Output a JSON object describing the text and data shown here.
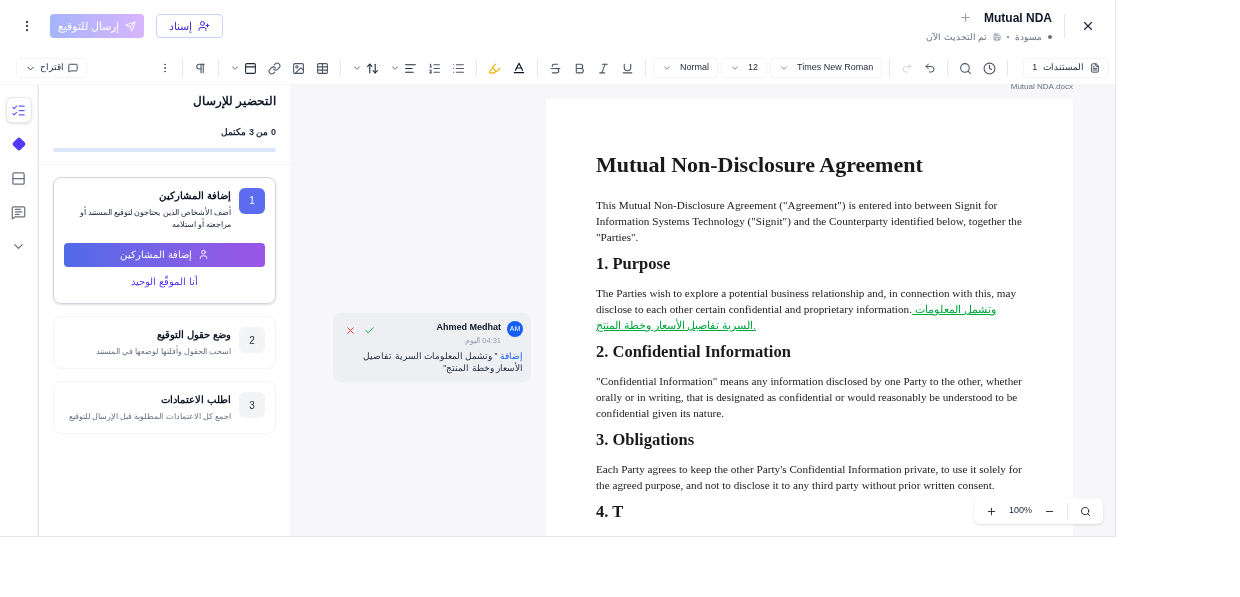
{
  "header": {
    "title": "Mutual NDA",
    "status": "مسودة",
    "updated": "تم التحديث الآن",
    "assign_button": "إسناد",
    "send_button": {
      "label": "إرسال للتوقيع",
      "disabled": true
    }
  },
  "toolbar": {
    "suggest_label": "اقتراح",
    "selects": [
      "Times New Roman",
      "12",
      "Normal"
    ],
    "documents": {
      "label": "المستندات",
      "count": "1"
    }
  },
  "rail": [
    {
      "kind": "checklist",
      "selected": true
    },
    {
      "kind": "diamond",
      "selected": false
    },
    {
      "kind": "rows",
      "selected": false
    },
    {
      "kind": "comment",
      "selected": false
    },
    {
      "kind": "chevron",
      "selected": false
    }
  ],
  "panel": {
    "title": "التحضير للإرسال",
    "progress_text": "0 من 3 مكتمل",
    "progress": {
      "level": 0
    },
    "steps": [
      {
        "number": "1",
        "title": "إضافة المشاركين",
        "description": "أضف الأشخاص الذين يحتاجون لتوقيع المستند أو مراجعته أو استلامه",
        "active": true,
        "primary_action": "إضافة المشاركين",
        "secondary_action": "أنا الموقّع الوحيد"
      },
      {
        "number": "2",
        "title": "وضع حقول التوقيع",
        "description": "اسحب الحقول وأفلتها لوضعها في المستند",
        "active": false
      },
      {
        "number": "3",
        "title": "اطلب الاعتمادات",
        "description": "اجمع كل الاعتمادات المطلوبة قبل الإرسال للتوقيع",
        "active": false
      }
    ]
  },
  "comment": {
    "initials": "AM",
    "author": "Ahmed Medhat",
    "time": "04:31 اليوم",
    "change_type": "إضافة",
    "text": "\" وتشمل المعلومات السرية تفاصيل الأسعار وخطة المنتج\""
  },
  "document": {
    "filename": "Mutual NDA.docx",
    "blocks": [
      {
        "kind": "title",
        "text": "Mutual Non-Disclosure Agreement"
      },
      {
        "kind": "paragraph",
        "text": "This Mutual Non-Disclosure Agreement (\"Agreement\") is entered into between Signit for Information Systems Technology (\"Signit\") and the Counterparty identified below, together the \"Parties\"."
      },
      {
        "kind": "heading",
        "text": "1. Purpose"
      },
      {
        "kind": "paragraph",
        "text": "The Parties wish to explore a potential business relationship and, in connection with this, may disclose to each other certain confidential and proprietary information.",
        "insertion": " وتشمل المعلومات السرية تفاصيل الأسعار وخطة المنتج."
      },
      {
        "kind": "heading",
        "text": "2. Confidential Information"
      },
      {
        "kind": "paragraph",
        "text": "\"Confidential Information\" means any information disclosed by one Party to the other, whether orally or in writing, that is designated as confidential or would reasonably be understood to be confidential given its nature."
      },
      {
        "kind": "heading",
        "text": "3. Obligations"
      },
      {
        "kind": "paragraph",
        "text": "Each Party agrees to keep the other Party's Confidential Information private, to use it solely for the agreed purpose, and not to disclose it to any third party without prior written consent."
      },
      {
        "kind": "heading",
        "text": "4. T"
      }
    ]
  },
  "zoom": {
    "level_text": "100%"
  }
}
